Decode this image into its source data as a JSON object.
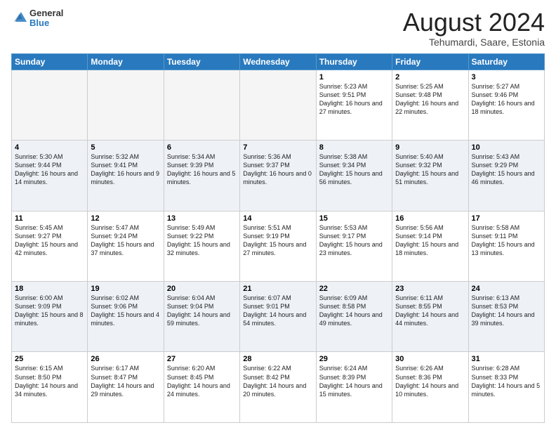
{
  "logo": {
    "general": "General",
    "blue": "Blue"
  },
  "header": {
    "month": "August 2024",
    "location": "Tehumardi, Saare, Estonia"
  },
  "weekdays": [
    "Sunday",
    "Monday",
    "Tuesday",
    "Wednesday",
    "Thursday",
    "Friday",
    "Saturday"
  ],
  "weeks": [
    [
      {
        "day": "",
        "empty": true
      },
      {
        "day": "",
        "empty": true
      },
      {
        "day": "",
        "empty": true
      },
      {
        "day": "",
        "empty": true
      },
      {
        "day": "1",
        "sunrise": "5:23 AM",
        "sunset": "9:51 PM",
        "daylight": "16 hours and 27 minutes."
      },
      {
        "day": "2",
        "sunrise": "5:25 AM",
        "sunset": "9:48 PM",
        "daylight": "16 hours and 22 minutes."
      },
      {
        "day": "3",
        "sunrise": "5:27 AM",
        "sunset": "9:46 PM",
        "daylight": "16 hours and 18 minutes."
      }
    ],
    [
      {
        "day": "4",
        "sunrise": "5:30 AM",
        "sunset": "9:44 PM",
        "daylight": "16 hours and 14 minutes."
      },
      {
        "day": "5",
        "sunrise": "5:32 AM",
        "sunset": "9:41 PM",
        "daylight": "16 hours and 9 minutes."
      },
      {
        "day": "6",
        "sunrise": "5:34 AM",
        "sunset": "9:39 PM",
        "daylight": "16 hours and 5 minutes."
      },
      {
        "day": "7",
        "sunrise": "5:36 AM",
        "sunset": "9:37 PM",
        "daylight": "16 hours and 0 minutes."
      },
      {
        "day": "8",
        "sunrise": "5:38 AM",
        "sunset": "9:34 PM",
        "daylight": "15 hours and 56 minutes."
      },
      {
        "day": "9",
        "sunrise": "5:40 AM",
        "sunset": "9:32 PM",
        "daylight": "15 hours and 51 minutes."
      },
      {
        "day": "10",
        "sunrise": "5:43 AM",
        "sunset": "9:29 PM",
        "daylight": "15 hours and 46 minutes."
      }
    ],
    [
      {
        "day": "11",
        "sunrise": "5:45 AM",
        "sunset": "9:27 PM",
        "daylight": "15 hours and 42 minutes."
      },
      {
        "day": "12",
        "sunrise": "5:47 AM",
        "sunset": "9:24 PM",
        "daylight": "15 hours and 37 minutes."
      },
      {
        "day": "13",
        "sunrise": "5:49 AM",
        "sunset": "9:22 PM",
        "daylight": "15 hours and 32 minutes."
      },
      {
        "day": "14",
        "sunrise": "5:51 AM",
        "sunset": "9:19 PM",
        "daylight": "15 hours and 27 minutes."
      },
      {
        "day": "15",
        "sunrise": "5:53 AM",
        "sunset": "9:17 PM",
        "daylight": "15 hours and 23 minutes."
      },
      {
        "day": "16",
        "sunrise": "5:56 AM",
        "sunset": "9:14 PM",
        "daylight": "15 hours and 18 minutes."
      },
      {
        "day": "17",
        "sunrise": "5:58 AM",
        "sunset": "9:11 PM",
        "daylight": "15 hours and 13 minutes."
      }
    ],
    [
      {
        "day": "18",
        "sunrise": "6:00 AM",
        "sunset": "9:09 PM",
        "daylight": "15 hours and 8 minutes."
      },
      {
        "day": "19",
        "sunrise": "6:02 AM",
        "sunset": "9:06 PM",
        "daylight": "15 hours and 4 minutes."
      },
      {
        "day": "20",
        "sunrise": "6:04 AM",
        "sunset": "9:04 PM",
        "daylight": "14 hours and 59 minutes."
      },
      {
        "day": "21",
        "sunrise": "6:07 AM",
        "sunset": "9:01 PM",
        "daylight": "14 hours and 54 minutes."
      },
      {
        "day": "22",
        "sunrise": "6:09 AM",
        "sunset": "8:58 PM",
        "daylight": "14 hours and 49 minutes."
      },
      {
        "day": "23",
        "sunrise": "6:11 AM",
        "sunset": "8:55 PM",
        "daylight": "14 hours and 44 minutes."
      },
      {
        "day": "24",
        "sunrise": "6:13 AM",
        "sunset": "8:53 PM",
        "daylight": "14 hours and 39 minutes."
      }
    ],
    [
      {
        "day": "25",
        "sunrise": "6:15 AM",
        "sunset": "8:50 PM",
        "daylight": "14 hours and 34 minutes."
      },
      {
        "day": "26",
        "sunrise": "6:17 AM",
        "sunset": "8:47 PM",
        "daylight": "14 hours and 29 minutes."
      },
      {
        "day": "27",
        "sunrise": "6:20 AM",
        "sunset": "8:45 PM",
        "daylight": "14 hours and 24 minutes."
      },
      {
        "day": "28",
        "sunrise": "6:22 AM",
        "sunset": "8:42 PM",
        "daylight": "14 hours and 20 minutes."
      },
      {
        "day": "29",
        "sunrise": "6:24 AM",
        "sunset": "8:39 PM",
        "daylight": "14 hours and 15 minutes."
      },
      {
        "day": "30",
        "sunrise": "6:26 AM",
        "sunset": "8:36 PM",
        "daylight": "14 hours and 10 minutes."
      },
      {
        "day": "31",
        "sunrise": "6:28 AM",
        "sunset": "8:33 PM",
        "daylight": "14 hours and 5 minutes."
      }
    ]
  ],
  "labels": {
    "sunrise": "Sunrise:",
    "sunset": "Sunset:",
    "daylight": "Daylight:"
  }
}
